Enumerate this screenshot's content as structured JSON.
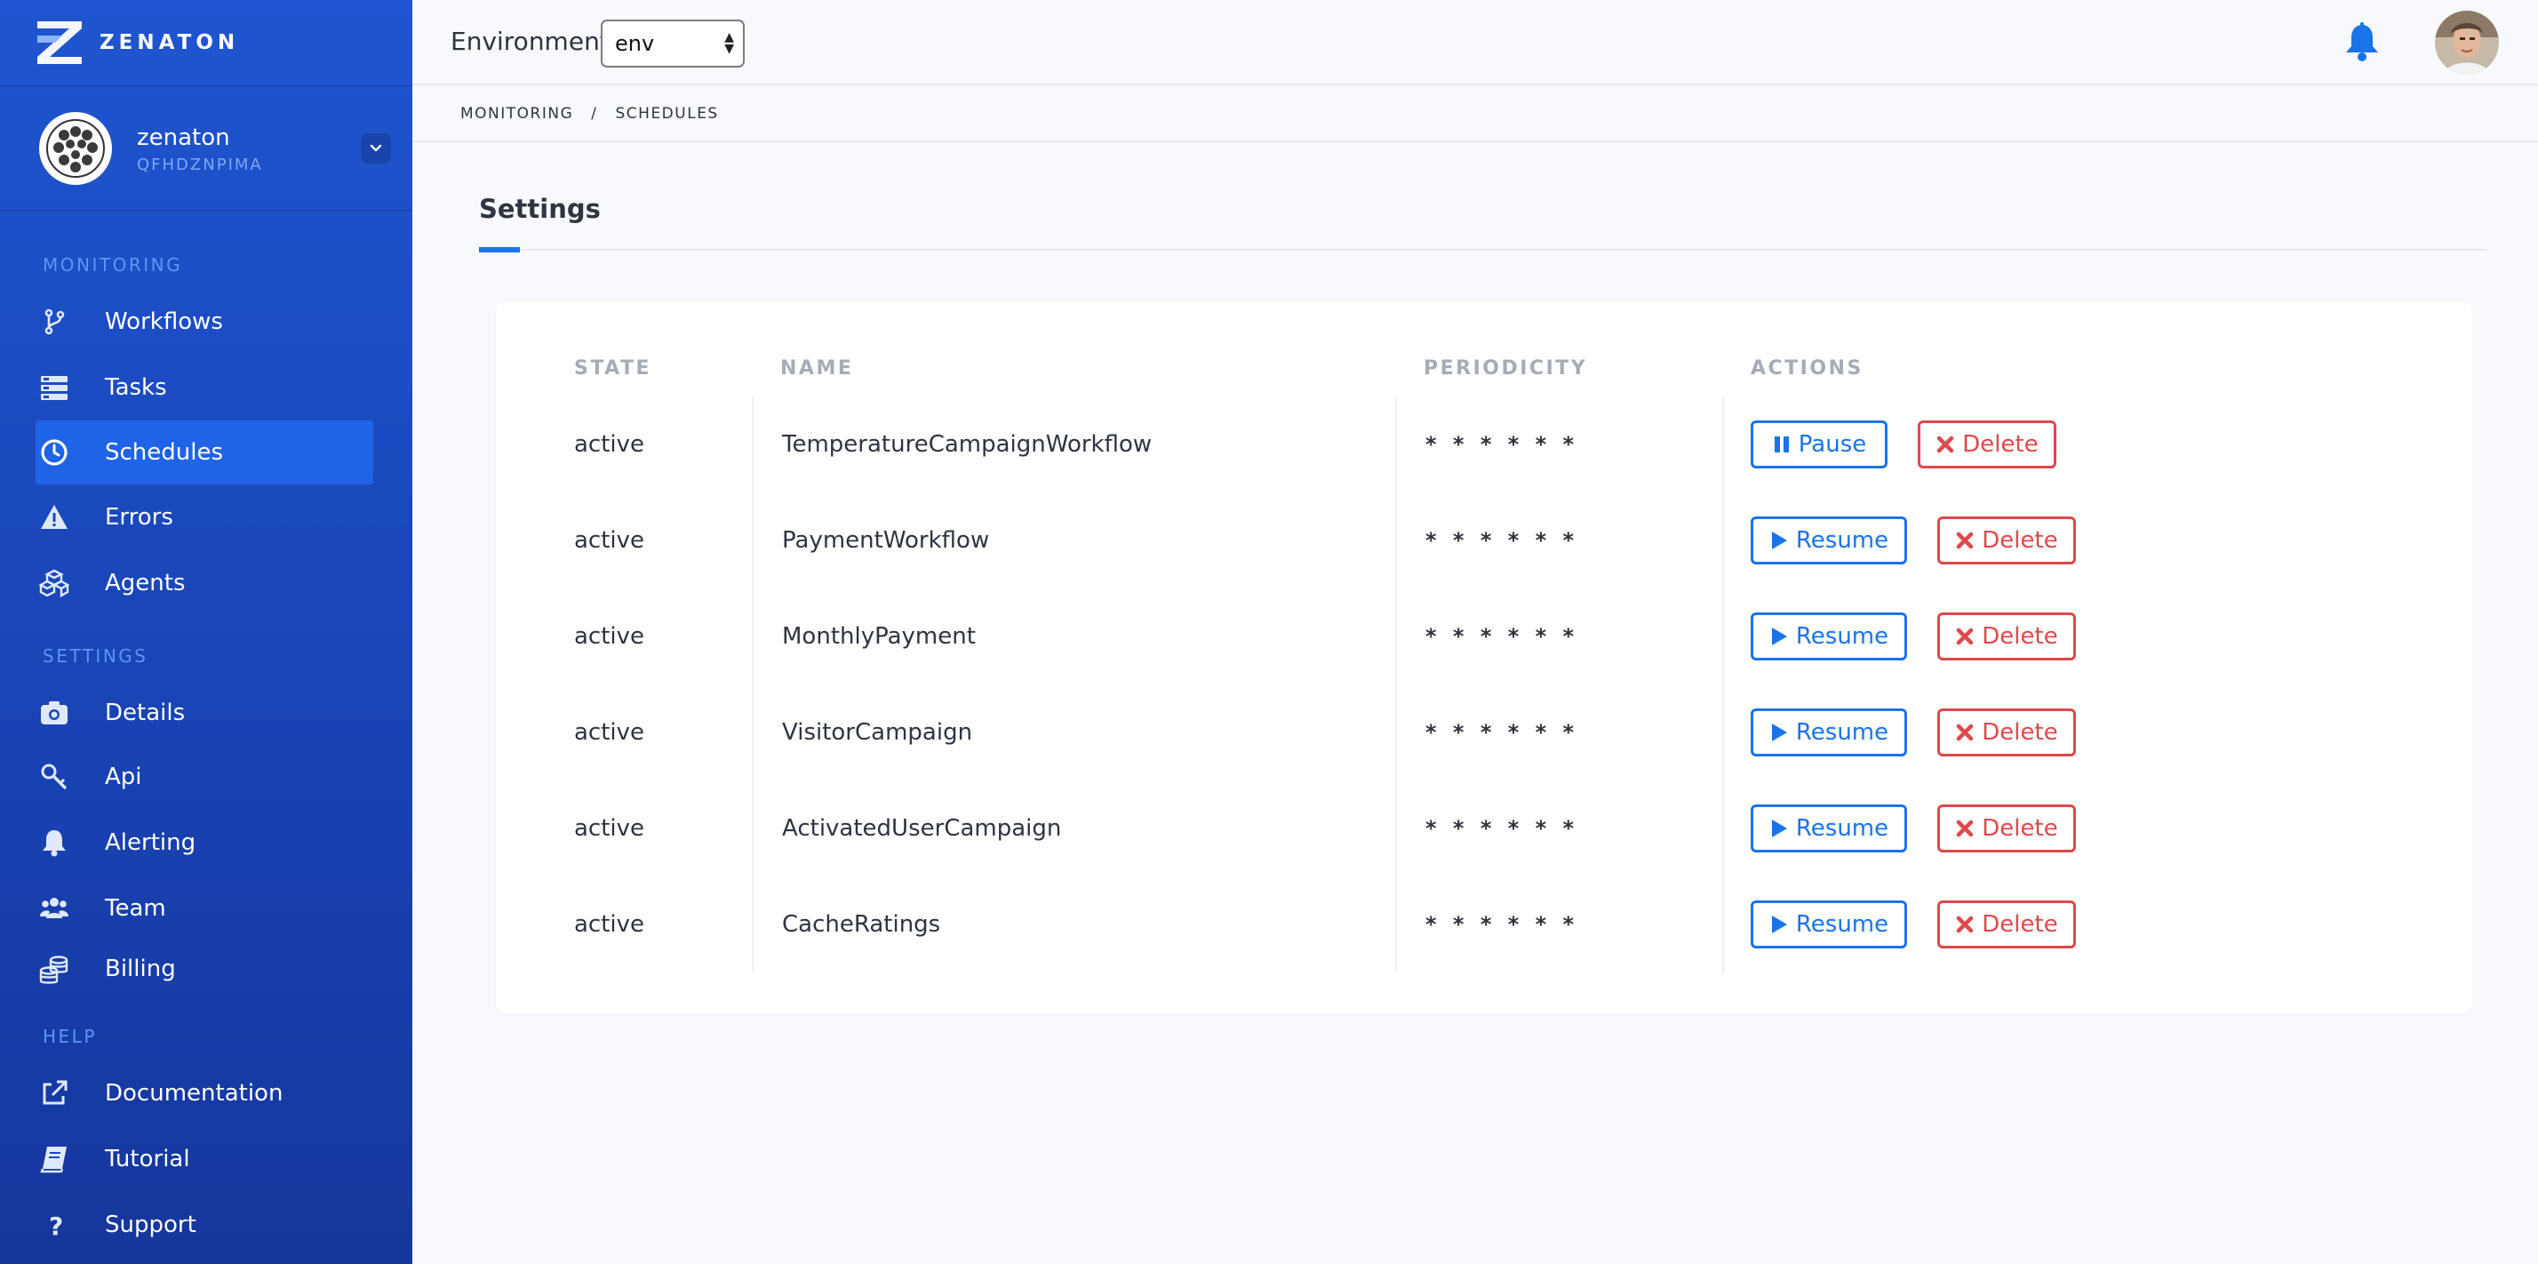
{
  "sidebar": {
    "brand": "ZENATON",
    "org": {
      "name": "zenaton",
      "id": "QFHDZNPIMA"
    },
    "sections": {
      "monitoring": "MONITORING",
      "settings": "SETTINGS",
      "help": "HELP"
    },
    "items": [
      {
        "label": "Workflows",
        "icon": "workflow-icon"
      },
      {
        "label": "Tasks",
        "icon": "tasks-icon"
      },
      {
        "label": "Schedules",
        "icon": "clock-icon",
        "active": true
      },
      {
        "label": "Errors",
        "icon": "warning-icon"
      },
      {
        "label": "Agents",
        "icon": "cubes-icon"
      },
      {
        "label": "Details",
        "icon": "camera-icon"
      },
      {
        "label": "Api",
        "icon": "key-icon"
      },
      {
        "label": "Alerting",
        "icon": "bell-icon"
      },
      {
        "label": "Team",
        "icon": "users-icon"
      },
      {
        "label": "Billing",
        "icon": "coins-icon"
      },
      {
        "label": "Documentation",
        "icon": "external-link-icon"
      },
      {
        "label": "Tutorial",
        "icon": "book-icon"
      },
      {
        "label": "Support",
        "icon": "question-icon"
      }
    ]
  },
  "topbar": {
    "env_label": "Environment",
    "env_value": "env"
  },
  "breadcrumb": {
    "first": "MONITORING",
    "sep": "/",
    "second": "SCHEDULES"
  },
  "page": {
    "title": "Settings"
  },
  "table": {
    "headers": {
      "state": "STATE",
      "name": "NAME",
      "periodicity": "PERIODICITY",
      "actions": "ACTIONS"
    },
    "rows": [
      {
        "state": "active",
        "name": "TemperatureCampaignWorkflow",
        "periodicity": "* * * * * *",
        "primary": "Pause",
        "secondary": "Delete"
      },
      {
        "state": "active",
        "name": "PaymentWorkflow",
        "periodicity": "* * * * * *",
        "primary": "Resume",
        "secondary": "Delete"
      },
      {
        "state": "active",
        "name": "MonthlyPayment",
        "periodicity": "* * * * * *",
        "primary": "Resume",
        "secondary": "Delete"
      },
      {
        "state": "active",
        "name": "VisitorCampaign",
        "periodicity": "* * * * * *",
        "primary": "Resume",
        "secondary": "Delete"
      },
      {
        "state": "active",
        "name": "ActivatedUserCampaign",
        "periodicity": "* * * * * *",
        "primary": "Resume",
        "secondary": "Delete"
      },
      {
        "state": "active",
        "name": "CacheRatings",
        "periodicity": "* * * * * *",
        "primary": "Resume",
        "secondary": "Delete"
      }
    ]
  },
  "colors": {
    "accent": "#1a73e8",
    "danger": "#e0474c",
    "sidebar": "#1a47bb"
  }
}
